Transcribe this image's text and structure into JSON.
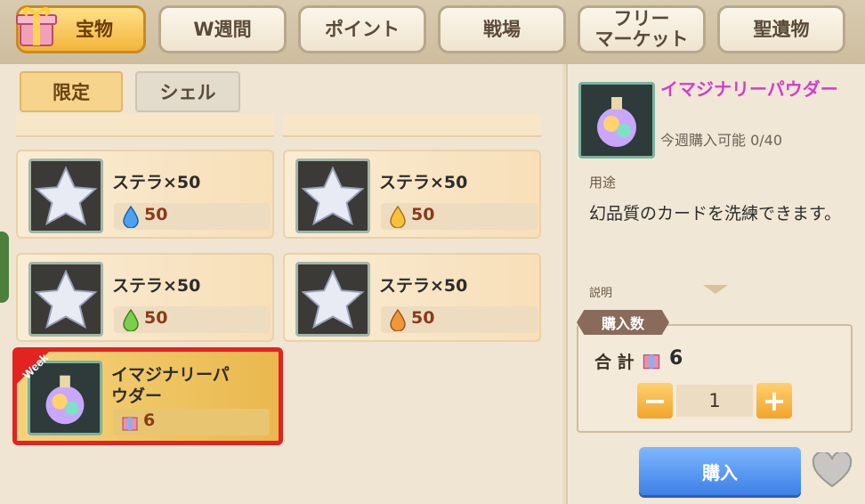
{
  "tabs": [
    {
      "label": "宝物",
      "active": true
    },
    {
      "label": "W週間",
      "active": false
    },
    {
      "label": "ポイント",
      "active": false
    },
    {
      "label": "戦場",
      "active": false
    },
    {
      "label": "フリー\nマーケット",
      "active": false
    },
    {
      "label": "聖遺物",
      "active": false
    }
  ],
  "subtabs": [
    {
      "label": "限定",
      "active": true
    },
    {
      "label": "シェル",
      "active": false
    }
  ],
  "items": [
    {
      "name": "ステラ×50",
      "price": "50",
      "currency": "blue-drop-icon"
    },
    {
      "name": "ステラ×50",
      "price": "50",
      "currency": "gold-drop-icon"
    },
    {
      "name": "ステラ×50",
      "price": "50",
      "currency": "green-drop-icon"
    },
    {
      "name": "ステラ×50",
      "price": "50",
      "currency": "orange-drop-icon"
    },
    {
      "name": "イマジナリーパウダー",
      "price": "6",
      "currency": "gift-currency-icon",
      "badge": "Week",
      "selected": true
    }
  ],
  "detail": {
    "name": "イマジナリーパウダー",
    "limit": "今週購入可能 0/40",
    "use_label": "用途",
    "use_text": "幻品質のカードを洗練できます。",
    "desc_label": "説明"
  },
  "purchase": {
    "tag": "購入数",
    "total_label": "合 計",
    "total_value": "6",
    "quantity": "1",
    "minus": "−",
    "plus": "+",
    "buy_label": "購入"
  },
  "colors": {
    "accent_gold": "#f3b53a",
    "selection_red": "#e32222",
    "buy_blue": "#3d7fe6",
    "item_name_pink": "#d43ccc"
  }
}
